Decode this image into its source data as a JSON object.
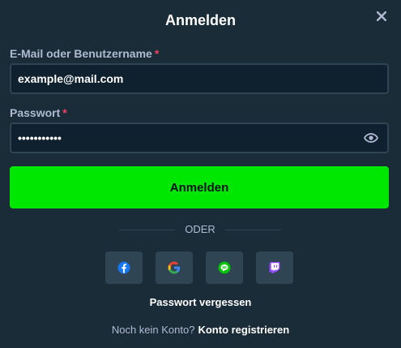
{
  "dialog": {
    "title": "Anmelden"
  },
  "form": {
    "email_label": "E-Mail oder Benutzername",
    "email_value": "example@mail.com",
    "password_label": "Passwort",
    "password_value": "•••••••••••",
    "required_marker": "*"
  },
  "submit_label": "Anmelden",
  "divider_text": "ODER",
  "social": [
    {
      "icon": "facebook-icon",
      "color": "#1877f2"
    },
    {
      "icon": "google-icon",
      "color": "#4285f4"
    },
    {
      "icon": "line-icon",
      "color": "#00c300"
    },
    {
      "icon": "twitch-icon",
      "color": "#9146ff"
    }
  ],
  "forgot_password": "Passwort vergessen",
  "register": {
    "prompt": "Noch kein Konto?",
    "link": "Konto registrieren"
  },
  "colors": {
    "background": "#1a2c38",
    "input_bg": "#0f212e",
    "accent_green": "#00e701",
    "label": "#b1bad3",
    "required": "#ed4163"
  }
}
